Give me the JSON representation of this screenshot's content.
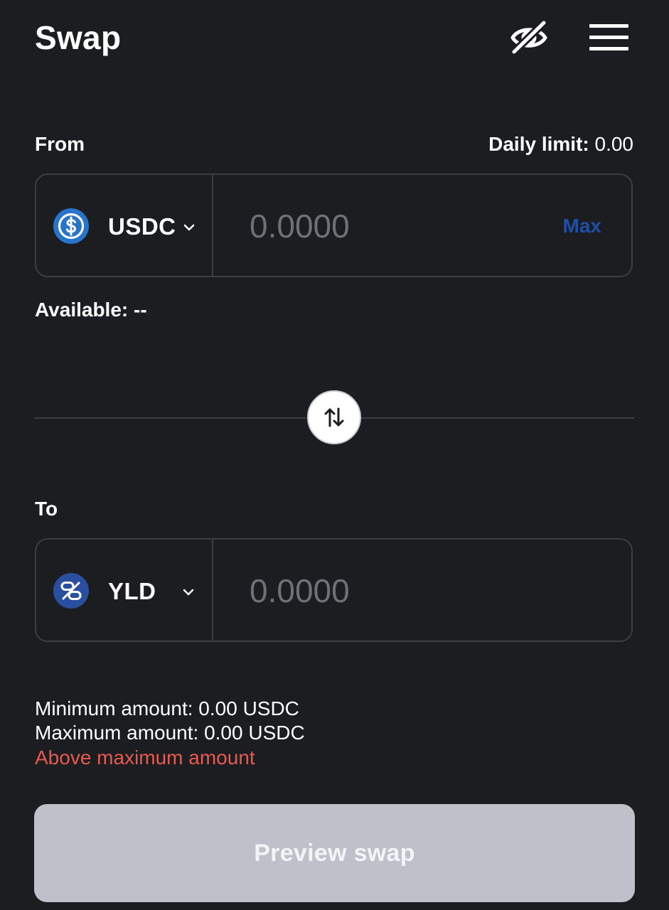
{
  "header": {
    "title": "Swap",
    "icons": [
      "eye-off-icon",
      "menu-icon"
    ]
  },
  "from": {
    "label": "From",
    "daily_limit_label": "Daily limit:",
    "daily_limit_value": "0.00",
    "token": {
      "name": "USDC",
      "icon": "usdc-icon",
      "color": "#2775ca"
    },
    "amount_placeholder": "0.0000",
    "max_label": "Max",
    "available_label": "Available: --"
  },
  "to": {
    "label": "To",
    "token": {
      "name": "YLD",
      "icon": "yld-icon",
      "color": "#2a4f9e"
    },
    "amount_placeholder": "0.0000"
  },
  "limits": {
    "minimum": "Minimum amount: 0.00 USDC",
    "maximum": "Maximum amount: 0.00 USDC",
    "error": "Above maximum amount"
  },
  "actions": {
    "preview_label": "Preview swap"
  },
  "colors": {
    "background": "#1c1d21",
    "accent": "#1f4fa8",
    "error": "#e85a4f",
    "button_disabled": "#bec1ca"
  }
}
